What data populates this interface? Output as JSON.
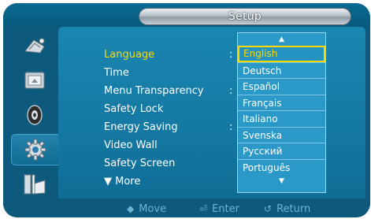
{
  "window": {
    "title": "Setup"
  },
  "sidebar": {
    "icons": [
      {
        "name": "picture-icon"
      },
      {
        "name": "screen-icon"
      },
      {
        "name": "sound-icon"
      },
      {
        "name": "setup-gear-icon"
      },
      {
        "name": "multi-control-icon"
      }
    ],
    "active_index": 3
  },
  "menu": {
    "items": [
      {
        "label": "Language",
        "selected": true
      },
      {
        "label": "Time"
      },
      {
        "label": "Menu Transparency"
      },
      {
        "label": "Safety Lock"
      },
      {
        "label": "Energy Saving"
      },
      {
        "label": "Video Wall"
      },
      {
        "label": "Safety Screen"
      },
      {
        "label": "▼ More"
      }
    ],
    "colon": ":"
  },
  "language_list": {
    "up_arrow": "▲",
    "down_arrow": "▼",
    "selected": "English",
    "options": [
      "English",
      "Deutsch",
      "Español",
      "Français",
      "Italiano",
      "Svenska",
      "Русский",
      "Português"
    ]
  },
  "help_bar": {
    "move": {
      "glyph": "◆",
      "label": "Move"
    },
    "enter": {
      "glyph": "⏎",
      "label": "Enter"
    },
    "return": {
      "glyph": "↺",
      "label": "Return"
    }
  },
  "colors": {
    "frame": "#0e5a7c",
    "panel": "#1479a3",
    "highlight_text": "#ffd800",
    "help_text": "#6fb3d1"
  }
}
